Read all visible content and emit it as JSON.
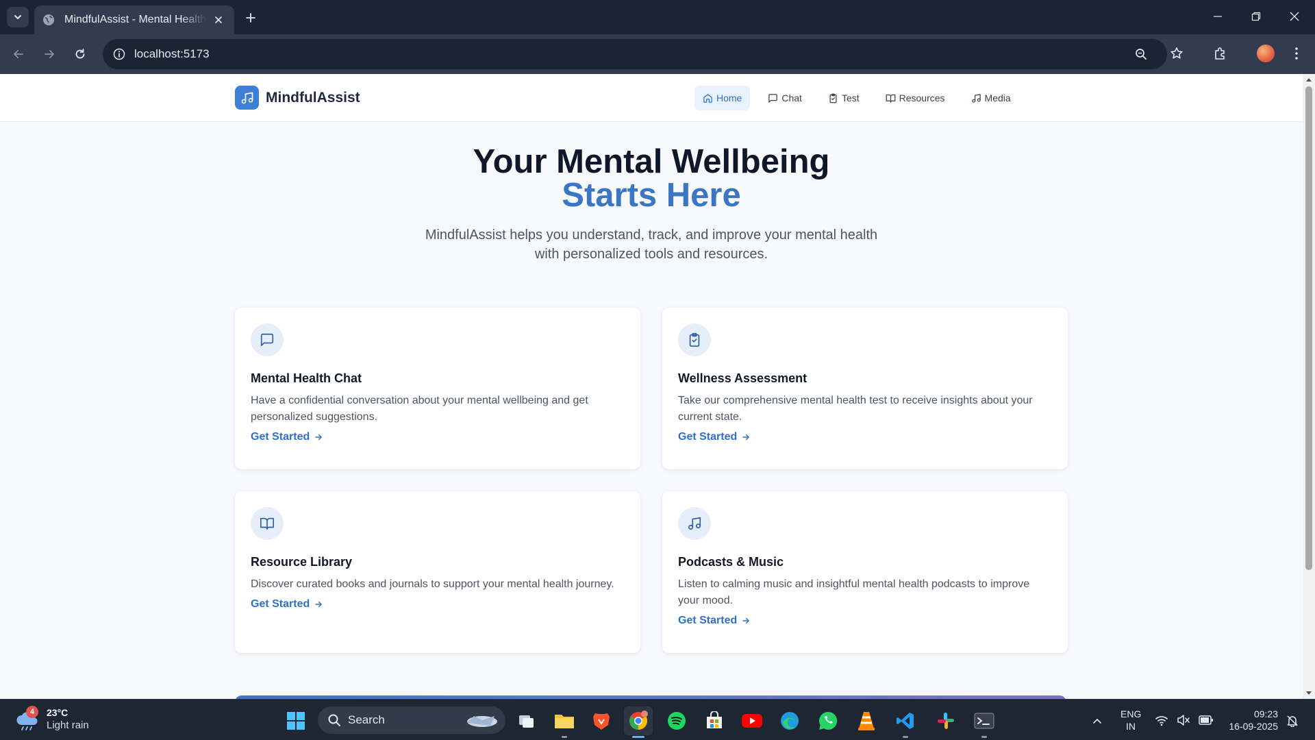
{
  "browser": {
    "tab_title": "MindfulAssist - Mental Health Assistant",
    "url": "localhost:5173"
  },
  "site": {
    "brand": "MindfulAssist",
    "nav": [
      "Home",
      "Chat",
      "Test",
      "Resources",
      "Media"
    ],
    "active_nav": "Home",
    "accent_color": "#3b76c4"
  },
  "hero": {
    "title_line1": "Your Mental Wellbeing",
    "title_line2": "Starts Here",
    "subtitle_line1": "MindfulAssist helps you understand, track, and improve your mental health",
    "subtitle_line2": "with personalized tools and resources."
  },
  "cards": [
    {
      "icon": "message-square-icon",
      "title": "Mental Health Chat",
      "description": "Have a confidential conversation about your mental wellbeing and get personalized suggestions.",
      "link": "Get Started"
    },
    {
      "icon": "clipboard-check-icon",
      "title": "Wellness Assessment",
      "description": "Take our comprehensive mental health test to receive insights about your current state.",
      "link": "Get Started"
    },
    {
      "icon": "book-open-icon",
      "title": "Resource Library",
      "description": "Discover curated books and journals to support your mental health journey.",
      "link": "Get Started"
    },
    {
      "icon": "music-icon",
      "title": "Podcasts & Music",
      "description": "Listen to calming music and insightful mental health podcasts to improve your mood.",
      "link": "Get Started"
    }
  ],
  "taskbar": {
    "weather_badge": "4",
    "temperature": "23°C",
    "condition": "Light rain",
    "search_label": "Search",
    "lang_line1": "ENG",
    "lang_line2": "IN",
    "time": "09:23",
    "date": "16-09-2025"
  }
}
